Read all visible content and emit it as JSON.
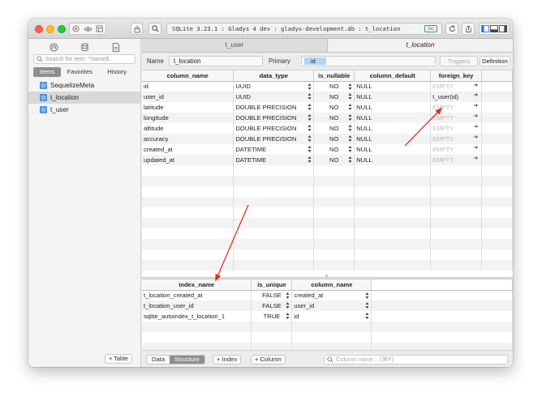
{
  "window": {
    "address": "SQLite 3.23.1 : Gladys 4 dev : gladys-development.db : t_location",
    "env_badge": "loc"
  },
  "toolbar": {
    "icons": [
      "stop-icon",
      "eye-icon",
      "grid-icon",
      "lock-icon",
      "search-icon",
      "refresh-icon",
      "upload-icon",
      "sidebar-toggle-icon",
      "bottom-panel-icon",
      "right-panel-icon"
    ]
  },
  "sidebar": {
    "search_placeholder": "Search for item: ^name$...",
    "tabs": [
      "Items",
      "Favorites",
      "History"
    ],
    "active_tab": "Items",
    "items": [
      {
        "label": "SequelizeMeta",
        "selected": false
      },
      {
        "label": "t_location",
        "selected": true
      },
      {
        "label": "t_user",
        "selected": false
      }
    ],
    "add_table_label": "+ Table"
  },
  "tabs": {
    "items": [
      "t_user",
      "t_location"
    ],
    "active": "t_location"
  },
  "namebar": {
    "name_label": "Name",
    "name_value": "t_location",
    "primary_label": "Primary",
    "primary_value": "id",
    "triggers_label": "Triggers",
    "definition_label": "Definition"
  },
  "columns_grid": {
    "headers": [
      "column_name",
      "data_type",
      "is_nullable",
      "column_default",
      "foreign_key"
    ],
    "rows": [
      {
        "name": "id",
        "type": "UUID",
        "nullable": "NO",
        "default": "NULL",
        "fk": "EMPTY"
      },
      {
        "name": "user_id",
        "type": "UUID",
        "nullable": "NO",
        "default": "NULL",
        "fk": "t_user(id)"
      },
      {
        "name": "latitude",
        "type": "DOUBLE PRECISION",
        "nullable": "NO",
        "default": "NULL",
        "fk": "EMPTY"
      },
      {
        "name": "longitude",
        "type": "DOUBLE PRECISION",
        "nullable": "NO",
        "default": "NULL",
        "fk": "EMPTY"
      },
      {
        "name": "altitude",
        "type": "DOUBLE PRECISION",
        "nullable": "NO",
        "default": "NULL",
        "fk": "EMPTY"
      },
      {
        "name": "accuracy",
        "type": "DOUBLE PRECISION",
        "nullable": "NO",
        "default": "NULL",
        "fk": "EMPTY"
      },
      {
        "name": "created_at",
        "type": "DATETIME",
        "nullable": "NO",
        "default": "NULL",
        "fk": "EMPTY"
      },
      {
        "name": "updated_at",
        "type": "DATETIME",
        "nullable": "NO",
        "default": "NULL",
        "fk": "EMPTY"
      }
    ]
  },
  "index_grid": {
    "headers": [
      "index_name",
      "is_unique",
      "column_name"
    ],
    "rows": [
      {
        "name": "t_location_created_at",
        "unique": "FALSE",
        "column": "created_at"
      },
      {
        "name": "t_location_user_id",
        "unique": "FALSE",
        "column": "user_id"
      },
      {
        "name": "sqlite_autoindex_t_location_1",
        "unique": "TRUE",
        "column": "id"
      }
    ]
  },
  "bottombar": {
    "segments": [
      "Data",
      "Structure"
    ],
    "active_segment": "Structure",
    "add_index_label": "+ Index",
    "add_column_label": "+ Column",
    "search_placeholder": "Column name... (⌘F)"
  },
  "colors": {
    "annotation_arrow": "#e0321e",
    "selection": "#b7d3f5",
    "table_icon": "#4a90e2"
  }
}
